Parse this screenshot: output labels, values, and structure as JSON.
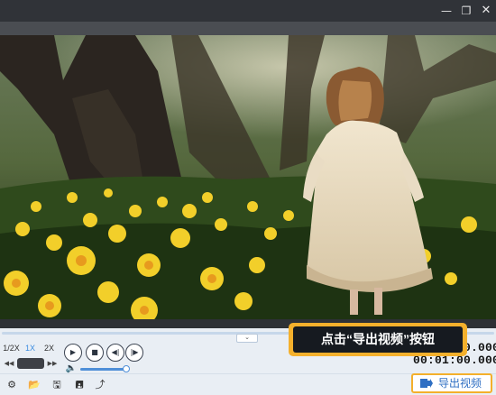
{
  "window": {
    "minimize_glyph": "—",
    "maximize_glyph": "❐",
    "close_glyph": "✕"
  },
  "player": {
    "seek_progress": 0.0,
    "speeds": [
      "1/2X",
      "1X",
      "2X"
    ],
    "active_speed": "1X",
    "volume_level": 0.95,
    "time_current": "00:00:00.000",
    "time_total": "00:01:00.000"
  },
  "tooltip": {
    "text": "点击“导出视频”按钮"
  },
  "toolbar": {
    "icons": [
      "settings-icon",
      "open-folder-icon",
      "save-icon",
      "save-as-icon",
      "share-icon"
    ],
    "export_label": "导出视频"
  },
  "colors": {
    "accent": "#4f8fd8",
    "highlight": "#f4b02c",
    "titlebar": "#303338"
  }
}
